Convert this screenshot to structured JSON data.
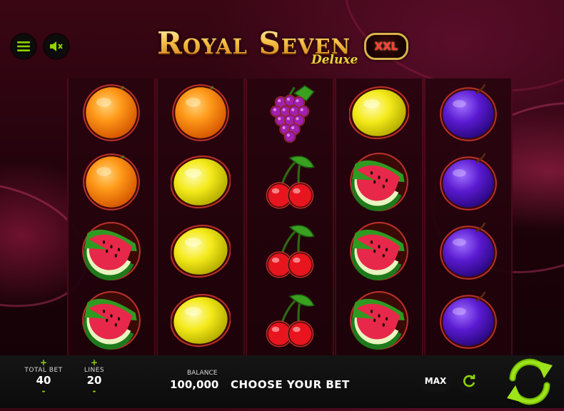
{
  "game": {
    "title": "Royal Seven",
    "subtitle": "Deluxe",
    "badge": "XXL"
  },
  "controls": {
    "menu_icon": "hamburger-menu-icon",
    "sound_icon": "speaker-muted-icon",
    "plus": "+",
    "minus": "-",
    "max_label": "MAX",
    "autoplay_icon": "autoplay-icon",
    "spin_icon": "spin-arrows-icon"
  },
  "bet": {
    "total_bet_label": "TOTAL BET",
    "total_bet_value": "40",
    "lines_label": "LINES",
    "lines_value": "20"
  },
  "balance": {
    "label": "BALANCE",
    "value": "100,000",
    "status": "CHOOSE YOUR BET"
  },
  "reels": [
    [
      "orange",
      "orange",
      "watermelon",
      "watermelon"
    ],
    [
      "orange",
      "lemon",
      "lemon",
      "lemon"
    ],
    [
      "grapes",
      "cherry",
      "cherry",
      "cherry"
    ],
    [
      "lemon",
      "watermelon",
      "watermelon",
      "watermelon"
    ],
    [
      "plum",
      "plum",
      "plum",
      "plum"
    ]
  ],
  "colors": {
    "accent_green": "#8fd400",
    "logo_gold": "#f7c14a",
    "background": "#1c0209"
  }
}
